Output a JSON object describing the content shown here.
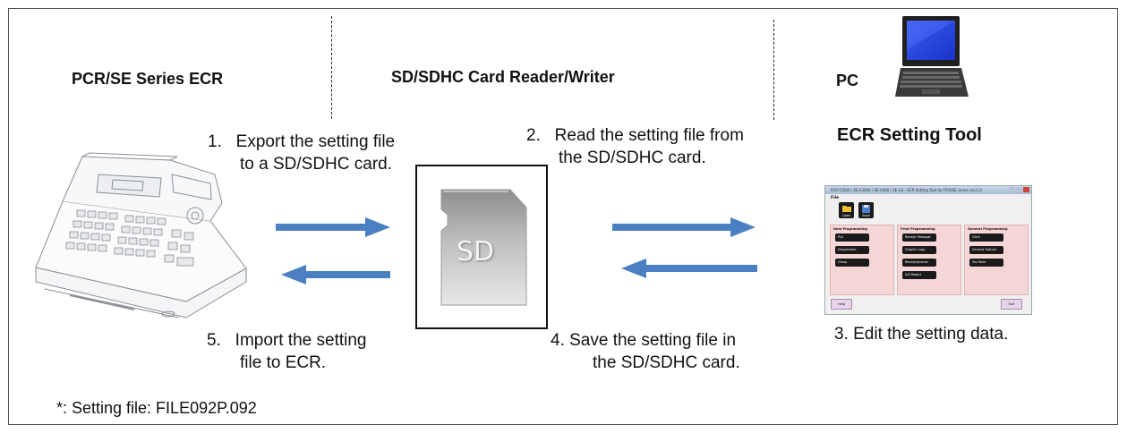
{
  "headings": {
    "ecr": "PCR/SE Series ECR",
    "reader": "SD/SDHC Card Reader/Writer",
    "pc": "PC",
    "tool": "ECR Setting Tool"
  },
  "steps": {
    "s1_line1": "1.   Export the setting file",
    "s1_line2": "to a SD/SDHC card.",
    "s2_line1": "2.   Read the setting file from",
    "s2_line2": "the SD/SDHC card.",
    "s3": "3. Edit the setting data.",
    "s4_line1": "4. Save the setting file in",
    "s4_line2": "the SD/SDHC card.",
    "s5_line1": "5.   Import the setting",
    "s5_line2": "file to ECR."
  },
  "footnote": "*: Setting file: FILE092P.092",
  "sd_card_label": "SD",
  "arrow_color": "#4a7fc1",
  "tool_window": {
    "title": "PCR-T2500 / SE-S3000 / SE-S400 / SE-G1 - ECR Setting Tool for PCR/SE series ver.1.0",
    "file_label": "File",
    "open_label": "Open",
    "save_label": "Save",
    "panels": [
      {
        "heading": "Item Programming",
        "buttons": [
          "PLU",
          "Department",
          "Group"
        ]
      },
      {
        "heading": "Print Programming",
        "buttons": [
          "Receipt Message",
          "Graphic Logo",
          "Receipt/Journal",
          "X/Z Report"
        ]
      },
      {
        "heading": "General Programming",
        "buttons": [
          "Clerk",
          "General Feature",
          "Tax Table"
        ]
      }
    ],
    "help_label": "Help",
    "exit_label": "Exit"
  }
}
